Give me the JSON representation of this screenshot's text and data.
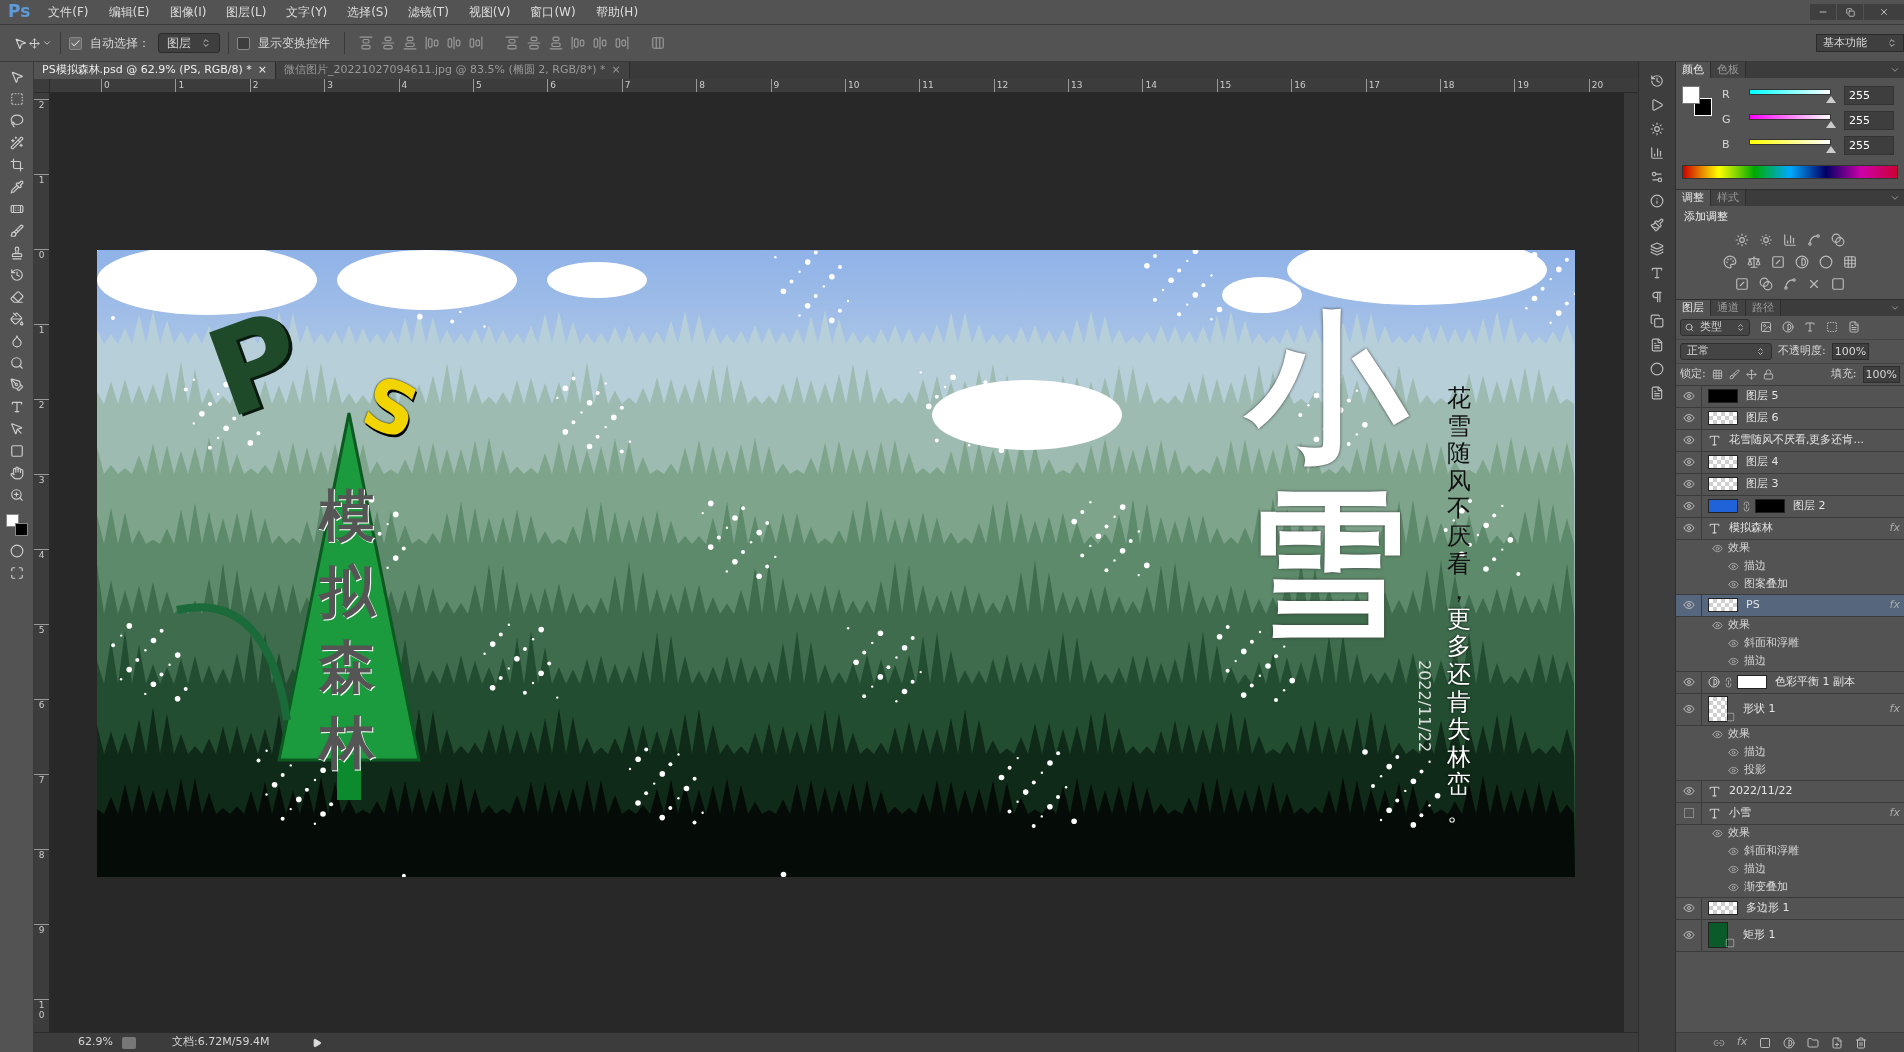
{
  "app": {
    "logo": "Ps"
  },
  "menu": [
    "文件(F)",
    "编辑(E)",
    "图像(I)",
    "图层(L)",
    "文字(Y)",
    "选择(S)",
    "滤镜(T)",
    "视图(V)",
    "窗口(W)",
    "帮助(H)"
  ],
  "options_bar": {
    "auto_select": {
      "label": "自动选择：",
      "checked": true
    },
    "target": "图层",
    "show_transform": {
      "label": "显示变换控件",
      "checked": false
    },
    "workspace": "基本功能"
  },
  "doc_tabs": [
    {
      "label": "PS模拟森林.psd @ 62.9% (PS, RGB/8) *",
      "close": "×",
      "selected": true
    },
    {
      "label": "微信图片_20221027094611.jpg @ 83.5% (椭圆 2, RGB/8*) *",
      "close": "×",
      "selected": false
    }
  ],
  "rulers": {
    "horizontal": [
      "0",
      "1",
      "2",
      "3",
      "4",
      "5",
      "6",
      "7",
      "8",
      "9",
      "10",
      "11",
      "12",
      "13",
      "14",
      "15",
      "16",
      "17",
      "18",
      "19",
      "20"
    ],
    "vertical": [
      "2",
      "1",
      "0",
      "1",
      "2",
      "3",
      "4",
      "5",
      "6",
      "7",
      "8",
      "9",
      "10"
    ]
  },
  "artwork": {
    "ps_letters": [
      "P",
      "S"
    ],
    "tree_text": "模拟森林",
    "title": "小雪",
    "poem": [
      "花雪随风不厌看，",
      "更多还肯失林峦。"
    ],
    "date": "2022/11/22"
  },
  "status_bar": {
    "zoom": "62.9%",
    "doc": "文档:6.72M/59.4M"
  },
  "color_panel": {
    "tabs": [
      {
        "label": "颜色",
        "selected": true
      },
      {
        "label": "色板",
        "selected": false
      }
    ],
    "channels": [
      {
        "name": "R",
        "level": 1,
        "value": "255"
      },
      {
        "name": "G",
        "level": 1,
        "value": "255"
      },
      {
        "name": "B",
        "level": 1,
        "value": "255"
      }
    ]
  },
  "adjustments_panel": {
    "tabs": [
      {
        "label": "调整",
        "selected": true
      },
      {
        "label": "样式",
        "selected": false
      }
    ],
    "heading": "添加调整"
  },
  "layers_panel": {
    "tabs": [
      {
        "label": "图层",
        "selected": true
      },
      {
        "label": "通道",
        "selected": false
      },
      {
        "label": "路径",
        "selected": false
      }
    ],
    "filter": "类型",
    "blend_mode": "正常",
    "opacity_label": "不透明度:",
    "opacity": "100%",
    "lock_label": "锁定:",
    "fill_label": "填充:",
    "fill": "100%",
    "footer_fx": "fx",
    "layers": [
      {
        "name": "图层 5",
        "kind": "pixel",
        "thumbnail": {
          "kind": "solid",
          "color": "#000000"
        },
        "visible": true,
        "selected": false
      },
      {
        "name": "图层 6",
        "kind": "pixel",
        "thumbnail": {
          "kind": "checker"
        },
        "visible": true,
        "selected": false
      },
      {
        "name": "花雪随风不厌看,更多还肯...",
        "kind": "text",
        "visible": true,
        "selected": false
      },
      {
        "name": "图层 4",
        "kind": "pixel",
        "thumbnail": {
          "kind": "checker"
        },
        "visible": true,
        "selected": false
      },
      {
        "name": "图层 3",
        "kind": "pixel",
        "thumbnail": {
          "kind": "checker"
        },
        "visible": true,
        "selected": false
      },
      {
        "name": "图层 2",
        "kind": "pixel",
        "thumbnail": {
          "kind": "solid",
          "color": "#2062d8"
        },
        "mask": {
          "kind": "solid",
          "color": "#000000"
        },
        "visible": true,
        "selected": false
      },
      {
        "name": "模拟森林",
        "kind": "text",
        "visible": true,
        "selected": false,
        "fx": "fx",
        "effects": {
          "label": "效果",
          "items": [
            "描边",
            "图案叠加"
          ]
        }
      },
      {
        "name": "PS",
        "kind": "pixel",
        "thumbnail": {
          "kind": "checker"
        },
        "visible": true,
        "selected": true,
        "fx": "fx",
        "effects": {
          "label": "效果",
          "items": [
            "斜面和浮雕",
            "描边"
          ]
        }
      },
      {
        "name": "色彩平衡 1 副本",
        "kind": "adjustment",
        "thumbnail": {
          "kind": "solid",
          "color": "#ffffff"
        },
        "visible": true,
        "selected": false
      },
      {
        "name": "形状 1",
        "kind": "shape",
        "thumbnail": {
          "kind": "checker"
        },
        "visible": true,
        "selected": false,
        "fx": "fx",
        "effects": {
          "label": "效果",
          "items": [
            "描边",
            "投影"
          ]
        }
      },
      {
        "name": "2022/11/22",
        "kind": "text",
        "visible": true,
        "selected": false
      },
      {
        "name": "小雪",
        "kind": "text",
        "visible": false,
        "selected": false,
        "fx": "fx",
        "effects": {
          "label": "效果",
          "items": [
            "斜面和浮雕",
            "描边",
            "渐变叠加"
          ]
        }
      },
      {
        "name": "多边形 1",
        "kind": "pixel",
        "thumbnail": {
          "kind": "checker"
        },
        "visible": true,
        "selected": false
      },
      {
        "name": "矩形 1",
        "kind": "shape",
        "thumbnail": {
          "kind": "solid",
          "color": "#0b5a2a"
        },
        "visible": true,
        "selected": false
      }
    ]
  }
}
